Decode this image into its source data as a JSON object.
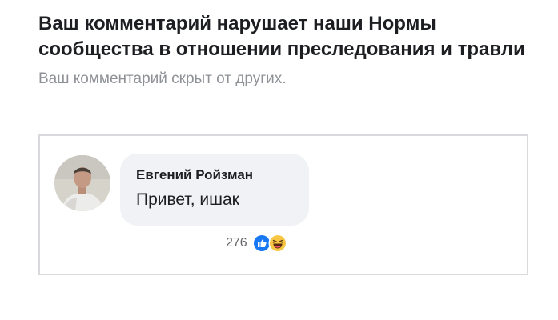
{
  "notice": {
    "title": "Ваш комментарий нарушает наши Нормы сообщества в отношении преследования и травли",
    "subtitle": "Ваш комментарий скрыт от других."
  },
  "comment": {
    "author": "Евгений Ройзман",
    "text": "Привет, ишак",
    "reaction_count": "276",
    "reactions": [
      "like-icon",
      "haha-icon"
    ]
  },
  "colors": {
    "title_text": "#1c1e21",
    "subtitle_text": "#8e9196",
    "bubble_bg": "#f0f2f5",
    "box_border": "#d9dadd",
    "like_blue": "#1877f2",
    "haha_yellow": "#f7c744"
  }
}
